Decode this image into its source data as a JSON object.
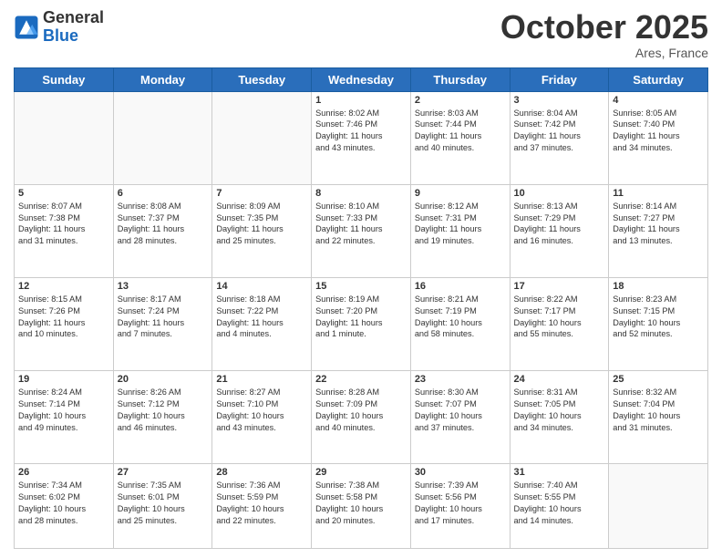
{
  "header": {
    "logo_general": "General",
    "logo_blue": "Blue",
    "month": "October 2025",
    "location": "Ares, France"
  },
  "weekdays": [
    "Sunday",
    "Monday",
    "Tuesday",
    "Wednesday",
    "Thursday",
    "Friday",
    "Saturday"
  ],
  "weeks": [
    [
      {
        "day": "",
        "info": ""
      },
      {
        "day": "",
        "info": ""
      },
      {
        "day": "",
        "info": ""
      },
      {
        "day": "1",
        "info": "Sunrise: 8:02 AM\nSunset: 7:46 PM\nDaylight: 11 hours\nand 43 minutes."
      },
      {
        "day": "2",
        "info": "Sunrise: 8:03 AM\nSunset: 7:44 PM\nDaylight: 11 hours\nand 40 minutes."
      },
      {
        "day": "3",
        "info": "Sunrise: 8:04 AM\nSunset: 7:42 PM\nDaylight: 11 hours\nand 37 minutes."
      },
      {
        "day": "4",
        "info": "Sunrise: 8:05 AM\nSunset: 7:40 PM\nDaylight: 11 hours\nand 34 minutes."
      }
    ],
    [
      {
        "day": "5",
        "info": "Sunrise: 8:07 AM\nSunset: 7:38 PM\nDaylight: 11 hours\nand 31 minutes."
      },
      {
        "day": "6",
        "info": "Sunrise: 8:08 AM\nSunset: 7:37 PM\nDaylight: 11 hours\nand 28 minutes."
      },
      {
        "day": "7",
        "info": "Sunrise: 8:09 AM\nSunset: 7:35 PM\nDaylight: 11 hours\nand 25 minutes."
      },
      {
        "day": "8",
        "info": "Sunrise: 8:10 AM\nSunset: 7:33 PM\nDaylight: 11 hours\nand 22 minutes."
      },
      {
        "day": "9",
        "info": "Sunrise: 8:12 AM\nSunset: 7:31 PM\nDaylight: 11 hours\nand 19 minutes."
      },
      {
        "day": "10",
        "info": "Sunrise: 8:13 AM\nSunset: 7:29 PM\nDaylight: 11 hours\nand 16 minutes."
      },
      {
        "day": "11",
        "info": "Sunrise: 8:14 AM\nSunset: 7:27 PM\nDaylight: 11 hours\nand 13 minutes."
      }
    ],
    [
      {
        "day": "12",
        "info": "Sunrise: 8:15 AM\nSunset: 7:26 PM\nDaylight: 11 hours\nand 10 minutes."
      },
      {
        "day": "13",
        "info": "Sunrise: 8:17 AM\nSunset: 7:24 PM\nDaylight: 11 hours\nand 7 minutes."
      },
      {
        "day": "14",
        "info": "Sunrise: 8:18 AM\nSunset: 7:22 PM\nDaylight: 11 hours\nand 4 minutes."
      },
      {
        "day": "15",
        "info": "Sunrise: 8:19 AM\nSunset: 7:20 PM\nDaylight: 11 hours\nand 1 minute."
      },
      {
        "day": "16",
        "info": "Sunrise: 8:21 AM\nSunset: 7:19 PM\nDaylight: 10 hours\nand 58 minutes."
      },
      {
        "day": "17",
        "info": "Sunrise: 8:22 AM\nSunset: 7:17 PM\nDaylight: 10 hours\nand 55 minutes."
      },
      {
        "day": "18",
        "info": "Sunrise: 8:23 AM\nSunset: 7:15 PM\nDaylight: 10 hours\nand 52 minutes."
      }
    ],
    [
      {
        "day": "19",
        "info": "Sunrise: 8:24 AM\nSunset: 7:14 PM\nDaylight: 10 hours\nand 49 minutes."
      },
      {
        "day": "20",
        "info": "Sunrise: 8:26 AM\nSunset: 7:12 PM\nDaylight: 10 hours\nand 46 minutes."
      },
      {
        "day": "21",
        "info": "Sunrise: 8:27 AM\nSunset: 7:10 PM\nDaylight: 10 hours\nand 43 minutes."
      },
      {
        "day": "22",
        "info": "Sunrise: 8:28 AM\nSunset: 7:09 PM\nDaylight: 10 hours\nand 40 minutes."
      },
      {
        "day": "23",
        "info": "Sunrise: 8:30 AM\nSunset: 7:07 PM\nDaylight: 10 hours\nand 37 minutes."
      },
      {
        "day": "24",
        "info": "Sunrise: 8:31 AM\nSunset: 7:05 PM\nDaylight: 10 hours\nand 34 minutes."
      },
      {
        "day": "25",
        "info": "Sunrise: 8:32 AM\nSunset: 7:04 PM\nDaylight: 10 hours\nand 31 minutes."
      }
    ],
    [
      {
        "day": "26",
        "info": "Sunrise: 7:34 AM\nSunset: 6:02 PM\nDaylight: 10 hours\nand 28 minutes."
      },
      {
        "day": "27",
        "info": "Sunrise: 7:35 AM\nSunset: 6:01 PM\nDaylight: 10 hours\nand 25 minutes."
      },
      {
        "day": "28",
        "info": "Sunrise: 7:36 AM\nSunset: 5:59 PM\nDaylight: 10 hours\nand 22 minutes."
      },
      {
        "day": "29",
        "info": "Sunrise: 7:38 AM\nSunset: 5:58 PM\nDaylight: 10 hours\nand 20 minutes."
      },
      {
        "day": "30",
        "info": "Sunrise: 7:39 AM\nSunset: 5:56 PM\nDaylight: 10 hours\nand 17 minutes."
      },
      {
        "day": "31",
        "info": "Sunrise: 7:40 AM\nSunset: 5:55 PM\nDaylight: 10 hours\nand 14 minutes."
      },
      {
        "day": "",
        "info": ""
      }
    ]
  ]
}
